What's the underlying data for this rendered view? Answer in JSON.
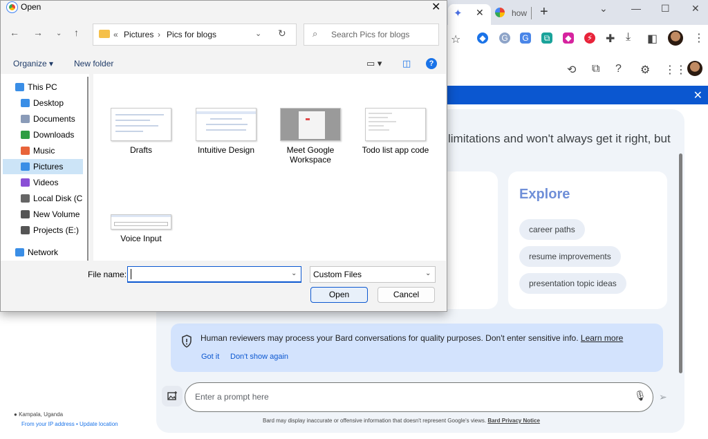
{
  "browser": {
    "tab2_text": "how",
    "main_text": "limitations and won't always get it right, but",
    "explore": {
      "title": "Explore",
      "chips": [
        "career paths",
        "resume improvements",
        "presentation topic ideas"
      ]
    },
    "notice": {
      "text": "Human reviewers may process your Bard conversations for quality purposes. Don't enter sensitive info.",
      "link": "Learn more",
      "got_it": "Got it",
      "dont_show": "Don't show again"
    },
    "prompt_placeholder": "Enter a prompt here",
    "footnote_text": "Bard may display inaccurate or offensive information that doesn't represent Google's views.",
    "footnote_link": "Bard Privacy Notice",
    "location": "Kampala, Uganda",
    "location_sub": "From your IP address • Update location"
  },
  "dialog": {
    "title": "Open",
    "breadcrumb": [
      "«",
      "Pictures",
      "›",
      "Pics for blogs"
    ],
    "search_placeholder": "Search Pics for blogs",
    "organize": "Organize ▾",
    "new_folder": "New folder",
    "nav_items": [
      {
        "label": "This PC",
        "icon": "monitor-icon",
        "color": "#3a8ee6"
      },
      {
        "label": "Desktop",
        "icon": "desktop-icon",
        "color": "#3a8ee6"
      },
      {
        "label": "Documents",
        "icon": "documents-icon",
        "color": "#8a9bb8"
      },
      {
        "label": "Downloads",
        "icon": "download-icon",
        "color": "#2f9e44"
      },
      {
        "label": "Music",
        "icon": "music-icon",
        "color": "#e8643a"
      },
      {
        "label": "Pictures",
        "icon": "pictures-icon",
        "color": "#3a8ee6"
      },
      {
        "label": "Videos",
        "icon": "videos-icon",
        "color": "#8a4fd6"
      },
      {
        "label": "Local Disk (C",
        "icon": "drive-icon",
        "color": "#666666"
      },
      {
        "label": "New Volume",
        "icon": "drive-icon",
        "color": "#555555"
      },
      {
        "label": "Projects (E:)",
        "icon": "drive-icon",
        "color": "#555555"
      },
      {
        "label": "Network",
        "icon": "network-icon",
        "color": "#3a8ee6"
      }
    ],
    "files": [
      "Drafts",
      "Intuitive Design",
      "Meet Google Workspace",
      "Todo list app code",
      "Voice Input"
    ],
    "file_name_label": "File name:",
    "file_name_value": "",
    "file_type": "Custom Files",
    "open_label": "Open",
    "cancel_label": "Cancel"
  }
}
